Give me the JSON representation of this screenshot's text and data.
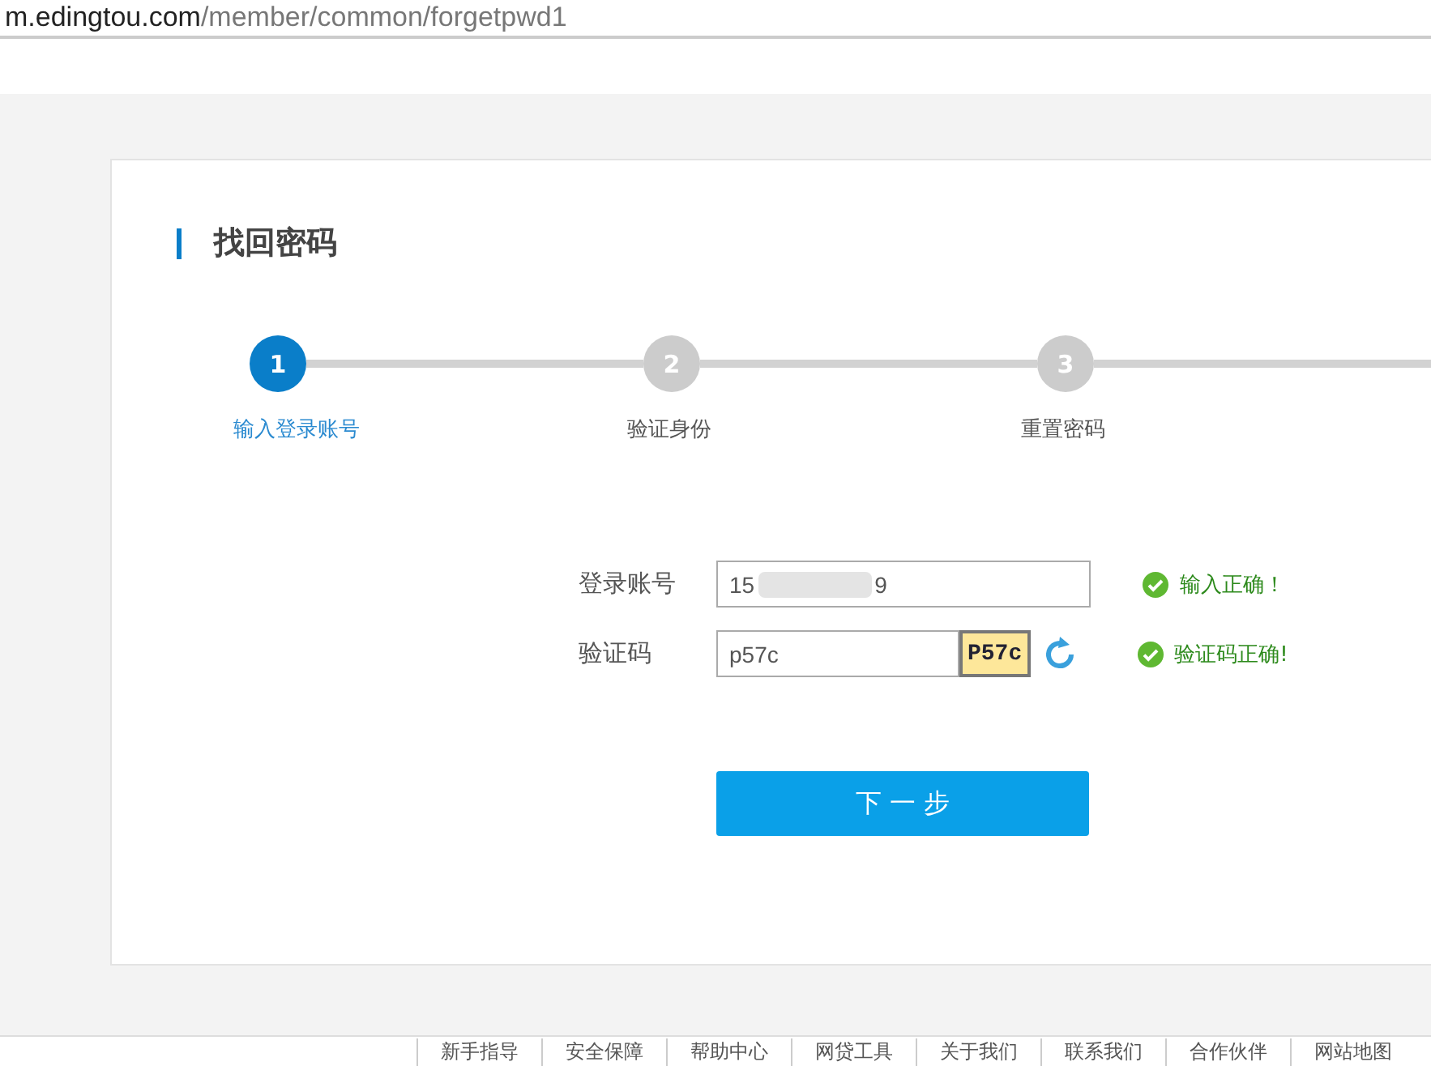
{
  "address_bar": {
    "host": "m.edingtou.com",
    "path": "/member/common/forgetpwd1"
  },
  "card": {
    "title": "找回密码"
  },
  "steps": [
    {
      "number": "1",
      "label": "输入登录账号",
      "selected": true
    },
    {
      "number": "2",
      "label": "验证身份",
      "selected": false
    },
    {
      "number": "3",
      "label": "重置密码",
      "selected": false
    }
  ],
  "form": {
    "account": {
      "label": "登录账号",
      "value_start": "15",
      "value_end": "9",
      "redacted": true,
      "status": "输入正确！",
      "valid": true
    },
    "captcha": {
      "label": "验证码",
      "value": "p57c",
      "image_text": "P57c",
      "status": "验证码正确!",
      "valid": true
    },
    "submit": "下 一 步"
  },
  "footer_links": [
    "新手指导",
    "安全保障",
    "帮助中心",
    "网贷工具",
    "关于我们",
    "联系我们",
    "合作伙伴",
    "网站地图"
  ]
}
